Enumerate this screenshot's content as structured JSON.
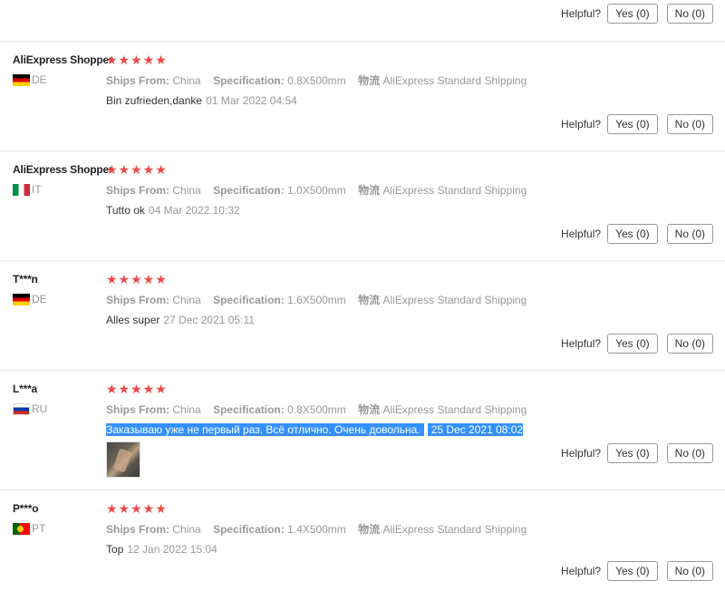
{
  "labels": {
    "helpful": "Helpful?",
    "yes": "Yes (0)",
    "no": "No (0)",
    "ships_from": "Ships From:",
    "specification": "Specification:",
    "shipping_key": "物流",
    "stars": "★★★★★"
  },
  "top_feedback": {
    "helpful": "Helpful?",
    "yes": "Yes (0)",
    "no": "No (0)"
  },
  "reviews": [
    {
      "name": "AliExpress Shopper",
      "country": "DE",
      "flag": "de",
      "rating": 5,
      "ships_from": "China",
      "specification": "0.8X500mm",
      "shipping": "AliExpress Standard Shipping",
      "text": "Bin zufrieden,danke",
      "date": "01 Mar 2022 04:54",
      "yes": "Yes (0)",
      "no": "No (0)"
    },
    {
      "name": "AliExpress Shopper",
      "country": "IT",
      "flag": "it",
      "rating": 5,
      "ships_from": "China",
      "specification": "1.0X500mm",
      "shipping": "AliExpress Standard Shipping",
      "text": "Tutto ok",
      "date": "04 Mar 2022 10:32",
      "yes": "Yes (0)",
      "no": "No (0)"
    },
    {
      "name": "T***n",
      "country": "DE",
      "flag": "de",
      "rating": 5,
      "ships_from": "China",
      "specification": "1.6X500mm",
      "shipping": "AliExpress Standard Shipping",
      "text": "Alles super",
      "date": "27 Dec 2021 05:11",
      "yes": "Yes (0)",
      "no": "No (0)"
    },
    {
      "name": "L***a",
      "country": "RU",
      "flag": "ru",
      "rating": 5,
      "ships_from": "China",
      "specification": "0.8X500mm",
      "shipping": "AliExpress Standard Shipping",
      "text": "Заказываю уже не первый раз. Всё отлично. Очень довольна.",
      "date": "25 Dec 2021 08:02",
      "selected": true,
      "has_photo": true,
      "yes": "Yes (0)",
      "no": "No (0)"
    },
    {
      "name": "P***o",
      "country": "PT",
      "flag": "pt",
      "rating": 5,
      "ships_from": "China",
      "specification": "1.4X500mm",
      "shipping": "AliExpress Standard Shipping",
      "text": "Top",
      "date": "12 Jan 2022 15:04",
      "yes": "Yes (0)",
      "no": "No (0)"
    }
  ]
}
